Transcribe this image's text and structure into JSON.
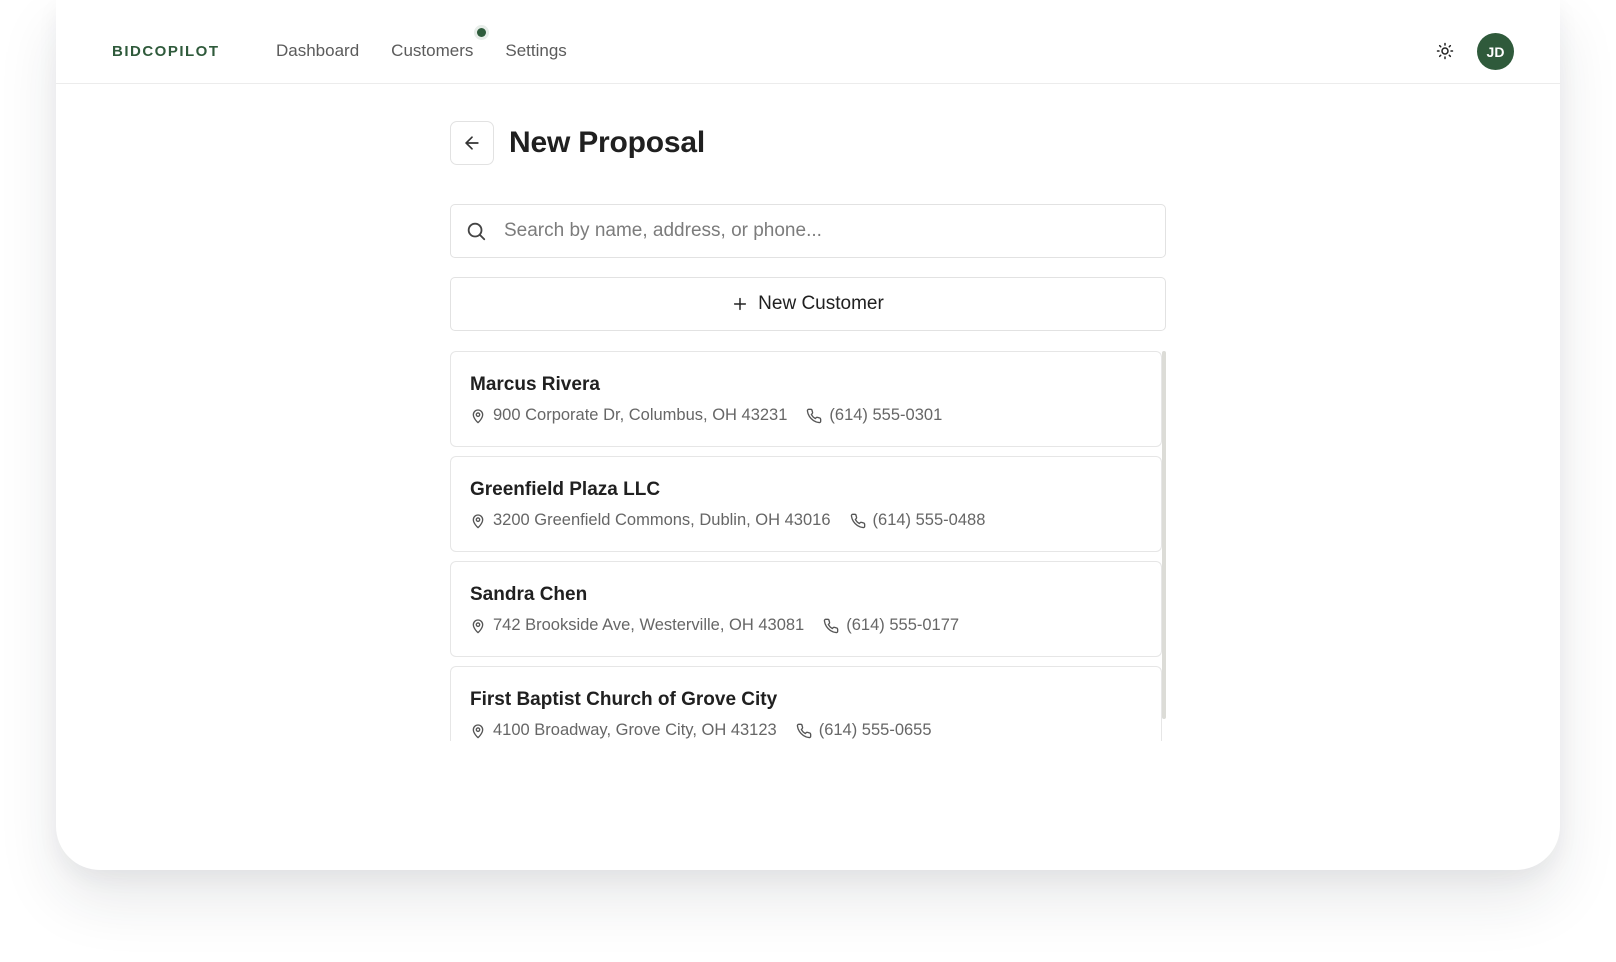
{
  "app": {
    "logo_text": "BIDCOPILOT",
    "brand_color": "#2f5a3b"
  },
  "nav": {
    "items": [
      {
        "label": "Dashboard"
      },
      {
        "label": "Customers",
        "has_indicator": true
      },
      {
        "label": "Settings"
      }
    ]
  },
  "header": {
    "theme_icon": "sun-icon",
    "avatar_initials": "JD"
  },
  "page": {
    "title": "New Proposal",
    "back_icon": "arrow-left-icon"
  },
  "search": {
    "placeholder": "Search by name, address, or phone...",
    "value": ""
  },
  "new_customer": {
    "label": "New Customer",
    "icon": "plus-icon"
  },
  "customers": [
    {
      "name": "Marcus Rivera",
      "address": "900 Corporate Dr, Columbus, OH 43231",
      "phone": "(614) 555-0301"
    },
    {
      "name": "Greenfield Plaza LLC",
      "address": "3200 Greenfield Commons, Dublin, OH 43016",
      "phone": "(614) 555-0488"
    },
    {
      "name": "Sandra Chen",
      "address": "742 Brookside Ave, Westerville, OH 43081",
      "phone": "(614) 555-0177"
    },
    {
      "name": "First Baptist Church of Grove City",
      "address": "4100 Broadway, Grove City, OH 43123",
      "phone": "(614) 555-0655"
    }
  ]
}
